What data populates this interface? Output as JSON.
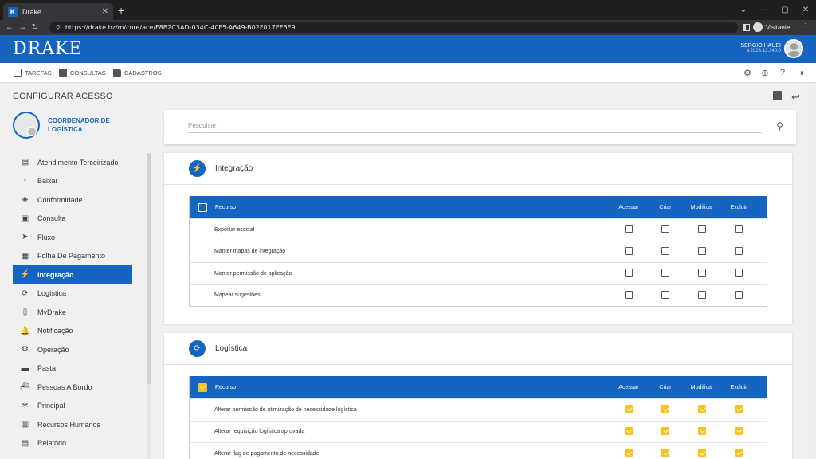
{
  "browser": {
    "tab_title": "Drake",
    "tab_favicon": "K",
    "url": "https://drake.bz/m/core/ace/F8B2C3AD-034C-40F5-A649-B02F017EF6E9",
    "profile_label": "Visitante"
  },
  "app": {
    "logo": "DRAKE",
    "user_name": "SERGIO HAUEI",
    "version": "v.2023.13.340.0",
    "brand_color": "#1565c0"
  },
  "menu": {
    "tarefas": "TAREFAS",
    "consultas": "CONSULTAS",
    "cadastros": "CADASTROS"
  },
  "page": {
    "title": "CONFIGURAR ACESSO",
    "role_name": "COORDENADOR DE LOGÍSTICA"
  },
  "search": {
    "placeholder": "Pesquisar"
  },
  "sidebar": {
    "items": [
      {
        "label": "Atendimento Terceirizado",
        "icon": "clipboard-icon",
        "glyph": "▤"
      },
      {
        "label": "Baixar",
        "icon": "download-icon",
        "glyph": "⭳"
      },
      {
        "label": "Conformidade",
        "icon": "handshake-icon",
        "glyph": "◈"
      },
      {
        "label": "Consulta",
        "icon": "list-box-icon",
        "glyph": "▣"
      },
      {
        "label": "Fluxo",
        "icon": "send-icon",
        "glyph": "➤"
      },
      {
        "label": "Folha De Pagamento",
        "icon": "payroll-icon",
        "glyph": "▦"
      },
      {
        "label": "Integração",
        "icon": "integration-icon",
        "glyph": "⚡"
      },
      {
        "label": "Logística",
        "icon": "route-icon",
        "glyph": "⟳"
      },
      {
        "label": "MyDrake",
        "icon": "phone-icon",
        "glyph": "▯"
      },
      {
        "label": "Notificação",
        "icon": "bell-icon",
        "glyph": "🔔"
      },
      {
        "label": "Operação",
        "icon": "operator-icon",
        "glyph": "⚙"
      },
      {
        "label": "Pasta",
        "icon": "folder-icon",
        "glyph": "▬"
      },
      {
        "label": "Pessoas A Bordo",
        "icon": "ship-icon",
        "glyph": "⛴"
      },
      {
        "label": "Principal",
        "icon": "hub-icon",
        "glyph": "✲"
      },
      {
        "label": "Recursos Humanos",
        "icon": "people-icon",
        "glyph": "▥"
      },
      {
        "label": "Relatório",
        "icon": "report-icon",
        "glyph": "▤"
      }
    ],
    "active_index": 6
  },
  "table_headers": {
    "resource": "Recurso",
    "acessar": "Acessar",
    "criar": "Criar",
    "modificar": "Modificar",
    "excluir": "Excluir"
  },
  "modules": [
    {
      "title": "Integração",
      "all_checked": false,
      "rows": [
        {
          "name": "Exportar esocial",
          "acessar": false,
          "criar": false,
          "modificar": false,
          "excluir": false
        },
        {
          "name": "Manter mapas de integração",
          "acessar": false,
          "criar": false,
          "modificar": false,
          "excluir": false
        },
        {
          "name": "Manter permissão de aplicação",
          "acessar": false,
          "criar": false,
          "modificar": false,
          "excluir": false
        },
        {
          "name": "Mapear sugestões",
          "acessar": false,
          "criar": false,
          "modificar": false,
          "excluir": false
        }
      ]
    },
    {
      "title": "Logística",
      "all_checked": true,
      "rows": [
        {
          "name": "Alterar permissão de otimização de necessidade logística",
          "acessar": true,
          "criar": true,
          "modificar": true,
          "excluir": true
        },
        {
          "name": "Alterar requisição logística aprovada",
          "acessar": true,
          "criar": true,
          "modificar": true,
          "excluir": true
        },
        {
          "name": "Alterar flag de pagamento de necessidade",
          "acessar": true,
          "criar": true,
          "modificar": true,
          "excluir": true
        }
      ]
    }
  ]
}
